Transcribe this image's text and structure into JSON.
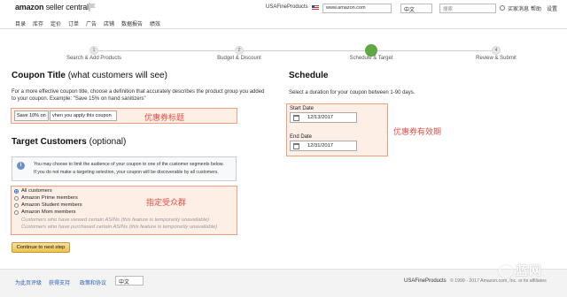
{
  "header": {
    "brand_bold": "amazon",
    "brand_light": " seller central",
    "store_name": "USAFineProducts",
    "marketplace": "www.amazon.com",
    "language": "中文",
    "search_placeholder": "搜索",
    "links": [
      "买家消息",
      "帮助",
      "设置"
    ]
  },
  "nav": {
    "items": [
      "目录",
      "库存",
      "定价",
      "订单",
      "广告",
      "店铺",
      "数据报告",
      "绩效"
    ]
  },
  "steps": [
    {
      "number": "1",
      "label": "Search & Add Products"
    },
    {
      "number": "2",
      "label": "Budget & Discount"
    },
    {
      "number": "",
      "label": "Schedule & Target"
    },
    {
      "number": "4",
      "label": "Review & Submit"
    }
  ],
  "coupon": {
    "title_bold": "Coupon Title",
    "title_normal": " (what customers will see)",
    "description": "For a more effective coupon title, choose a definition that accurately describes the product group you added to your coupon. Example: \"Save 15% on hand sanitizers\"",
    "prefix": "Save 10% on",
    "input_value": "vhen you apply this coupon",
    "annotation": "优惠券标题"
  },
  "target": {
    "title_bold": "Target Customers",
    "title_normal": " (optional)",
    "info_line1": "You may choose to limit the audience of your coupon to one of the customer segments below.",
    "info_line2": "If you do not make a targeting selection, your coupon will be discoverable by all customers.",
    "options": [
      {
        "label": "All customers"
      },
      {
        "label": "Amazon Prime members"
      },
      {
        "label": "Amazon Student members"
      },
      {
        "label": "Amazon Mom members"
      },
      {
        "label": "Customers who have viewed certain ASINs (this feature is temporarily unavailable)"
      },
      {
        "label": "Customers who have purchased certain ASINs (this feature is temporarily unavailable)"
      }
    ],
    "selected_index": 0,
    "annotation": "指定受众群",
    "continue_label": "Continue to next step"
  },
  "schedule": {
    "title": "Schedule",
    "description": "Select a duration for your coupon between 1-90 days.",
    "start_label": "Start Date",
    "start_value": "12/13/2017",
    "end_label": "End Date",
    "end_value": "12/31/2017",
    "annotation": "优惠券有效期"
  },
  "footer": {
    "links": [
      "为此页评级",
      "获得支持",
      "政策和协议"
    ],
    "language": "中文",
    "store": "USAFineProducts",
    "copyright": "© 1999 - 2017 Amazon.com, Inc. or its affiliates",
    "watermark": "蓝网"
  },
  "colors": {
    "accent_green": "#5fa843",
    "annotation_red": "#e0524a",
    "highlight_bg": "#fdeee6",
    "button_yellow": "#f0c14b",
    "link_blue": "#2a5db0"
  }
}
